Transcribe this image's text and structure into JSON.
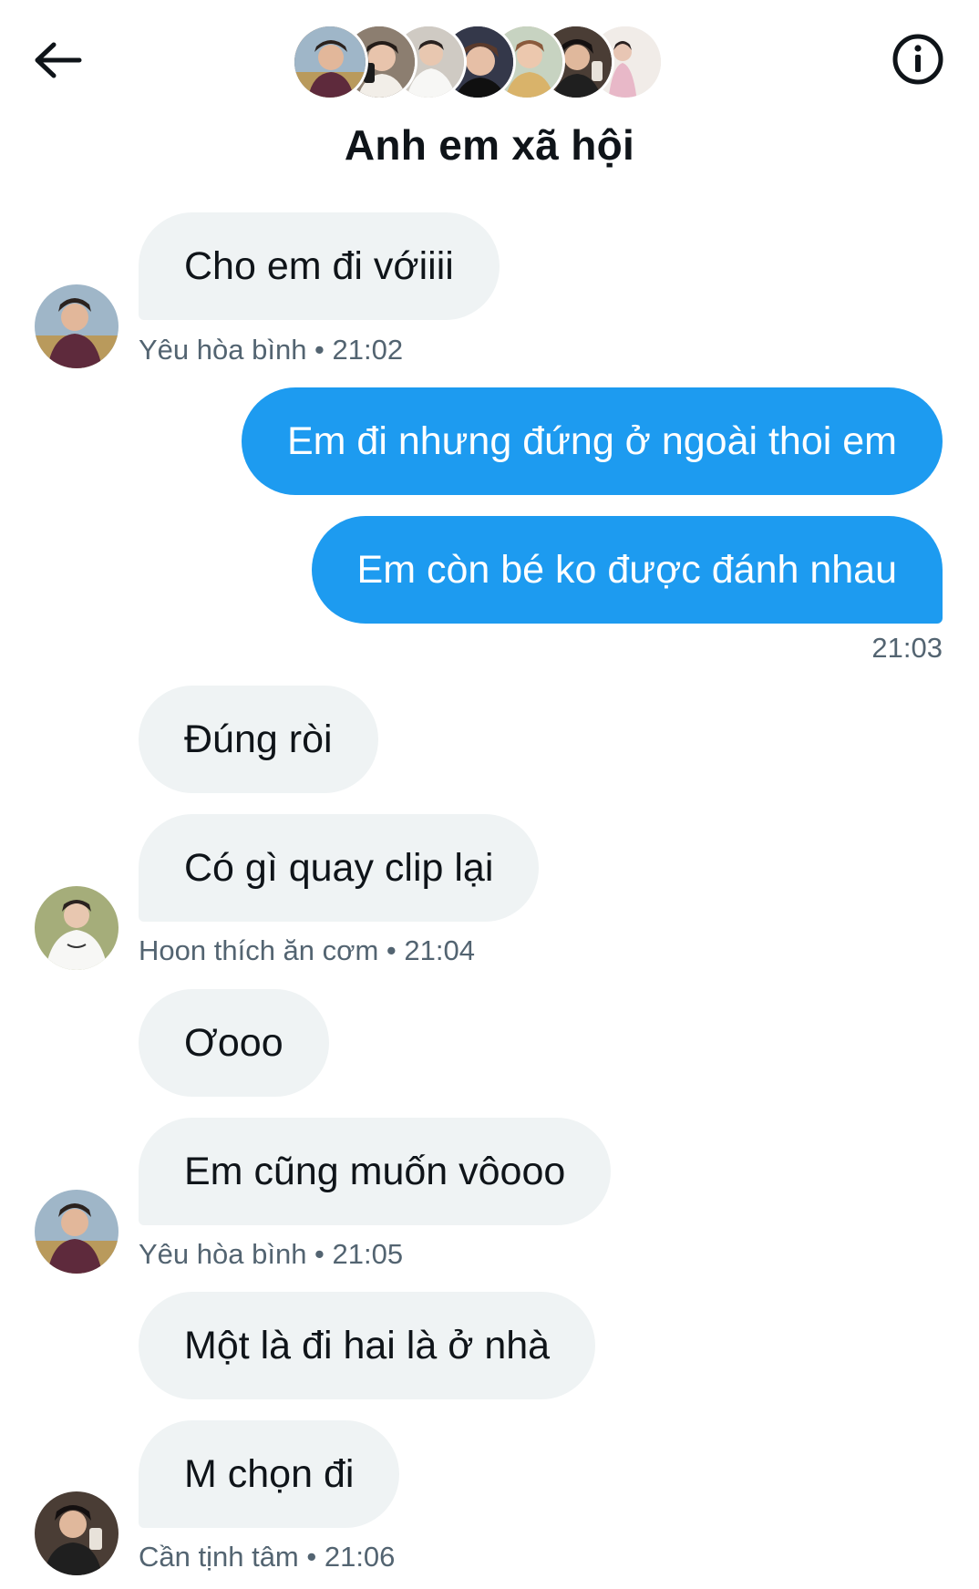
{
  "header": {
    "back_icon": "arrow-left-icon",
    "info_icon": "info-circle-icon",
    "title": "Anh em xã hội",
    "participant_count": 7
  },
  "messages": [
    {
      "side": "in",
      "text": "Cho em đi vớiiii"
    },
    {
      "meta": "Yêu hòa bình • 21:02"
    },
    {
      "side": "out",
      "text": "Em đi nhưng đứng ở ngoài thoi em"
    },
    {
      "side": "out",
      "text": "Em còn bé ko được đánh nhau"
    },
    {
      "meta": "21:03"
    },
    {
      "side": "in",
      "text": "Đúng ròi"
    },
    {
      "side": "in",
      "text": "Có gì quay clip lại"
    },
    {
      "meta": "Hoon thích ăn cơm • 21:04"
    },
    {
      "side": "in",
      "text": "Ơooo"
    },
    {
      "side": "in",
      "text": "Em cũng muốn vôooo"
    },
    {
      "meta": "Yêu hòa bình • 21:05"
    },
    {
      "side": "in",
      "text": "Một là đi hai là ở nhà"
    },
    {
      "side": "in",
      "text": "M chọn đi"
    },
    {
      "meta": "Cần tịnh tâm • 21:06"
    }
  ],
  "colors": {
    "outgoing_bubble": "#1d9bf0",
    "incoming_bubble": "#eff3f4",
    "meta_text": "#536471"
  }
}
